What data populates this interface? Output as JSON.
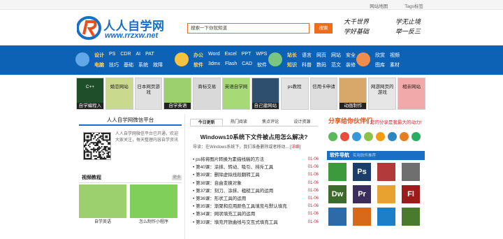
{
  "topbar": {
    "links": [
      "网站地图",
      "Tags标签"
    ]
  },
  "logo": {
    "cn": "人人自学网",
    "en": "www.rrzxw.net"
  },
  "search": {
    "placeholder": "搜索一下你就知道",
    "button": "搜索"
  },
  "slogan": {
    "line1": [
      "大千世界",
      "学无止境"
    ],
    "line2": [
      "学好基础",
      "举一反三"
    ]
  },
  "nav": {
    "groups": [
      {
        "icon_color": "#62a8e8",
        "row1": [
          "设计",
          "PS",
          "CDR",
          "AI",
          "PAT"
        ],
        "row2": [
          "电脑",
          "技巧",
          "基础",
          "系统",
          "故障"
        ]
      },
      {
        "icon_color": "#f5c242",
        "row1": [
          "办公",
          "Word",
          "Excel",
          "PPT",
          "WPS"
        ],
        "row2": [
          "软件",
          "3dmx",
          "Flash",
          "CAD",
          "软件"
        ]
      },
      {
        "icon_color": "#7bc67e",
        "row1": [
          "站长",
          "语言",
          "网页",
          "网站",
          "安全"
        ],
        "row2": [
          "知识",
          "科普",
          "数码",
          "范文",
          "装修"
        ]
      },
      {
        "icon_color": "#f08d4c",
        "row1": [
          "欣赏",
          "视频"
        ],
        "row2": [
          "图库",
          "素材"
        ]
      }
    ]
  },
  "banners": [
    {
      "text": "C++",
      "cap": "自学编程入门",
      "color": "#1f4f2a"
    },
    {
      "text": "婚恋网站",
      "cap": "",
      "color": "#c9d98e"
    },
    {
      "text": "日本网页游戏",
      "cap": "",
      "color": "#e0e0e0"
    },
    {
      "text": "",
      "cap": "自学英语",
      "color": "#9ccf6e"
    },
    {
      "text": "商标交易",
      "cap": "",
      "color": "#d9d9d9"
    },
    {
      "text": "英语自学网",
      "cap": "",
      "color": "#a7d977"
    },
    {
      "text": "",
      "cap": "自己建网站",
      "color": "#2f4f6f"
    },
    {
      "text": "ps教程",
      "cap": "",
      "color": "#e3e3e3"
    },
    {
      "text": "信用卡申请",
      "cap": "",
      "color": "#dedede"
    },
    {
      "text": "",
      "cap": "动画制作",
      "color": "#d7a86a"
    },
    {
      "text": "网游网页的游戏",
      "cap": "",
      "color": "#e6e6e6"
    },
    {
      "text": "相亲网站",
      "cap": "",
      "color": "#f1a9a9"
    }
  ],
  "wechat": {
    "title": "人人自学网微信平台",
    "text": "人人自学网微信平台已开通，欢迎大家关注，每天整理内容自学资讯"
  },
  "video": {
    "title": "视频教程",
    "more": "更多",
    "items": [
      {
        "caption": "自学英语",
        "color": "#9ccf6e"
      },
      {
        "caption": "怎么制作小程序",
        "color": "#7fcf5a"
      }
    ]
  },
  "tabs": [
    "今日更新",
    "热门阅读",
    "焦点评论",
    "设计资源"
  ],
  "featured": {
    "title": "Windows10系统下文件被占用怎么解决?",
    "desc": "导读：在Windows系统下，我们准备删除或者移动...",
    "more": "[详细]"
  },
  "news": [
    {
      "title": "ps将将图片转换为素描线稿的方法",
      "date": "01-06"
    },
    {
      "title": "第40课：涂抹、转动、吸引、排斥工具",
      "date": "01-06"
    },
    {
      "title": "第39课：删除虚拟线段翻转工具",
      "date": "01-06"
    },
    {
      "title": "第38课：自由变换对象",
      "date": "01-06"
    },
    {
      "title": "第37课：刻刀、涂抹、粗糙工具的运用",
      "date": "01-06"
    },
    {
      "title": "第36课：形状工具的运用",
      "date": "01-06"
    },
    {
      "title": "第35课：渐聚和应用颜色工具填充与默认填充",
      "date": "01-06"
    },
    {
      "title": "第34课：网状填充工具的运用",
      "date": "01-06"
    },
    {
      "title": "第33课：填充开放曲线与交互式填充工具",
      "date": "01-06"
    }
  ],
  "share": {
    "title": "分享给你伙伴们",
    "sub": "您的分享是我最大的动力!",
    "icons": [
      "#5cb85c",
      "#e74c3c",
      "#3498db",
      "#8bc34a",
      "#f39c12",
      "#2e86c1",
      "#e67e22",
      "#27ae60"
    ]
  },
  "software": {
    "title": "软件导航",
    "sub": "实用软件推荐",
    "items": [
      {
        "label": "",
        "color": "#3c9a3c"
      },
      {
        "label": "Ps",
        "color": "#1b3f6b"
      },
      {
        "label": "",
        "color": "#b33a3a"
      },
      {
        "label": "",
        "color": "#6f6f6f"
      },
      {
        "label": "Dw",
        "color": "#3d6b2b"
      },
      {
        "label": "Pr",
        "color": "#3b2d5c"
      },
      {
        "label": "",
        "color": "#e8a230"
      },
      {
        "label": "Fl",
        "color": "#9c1c1c"
      },
      {
        "label": "",
        "color": "#2d6aa8"
      },
      {
        "label": "",
        "color": "#d9691a"
      },
      {
        "label": "",
        "color": "#1e7fc9"
      },
      {
        "label": "",
        "color": "#4a7a2c"
      }
    ]
  }
}
